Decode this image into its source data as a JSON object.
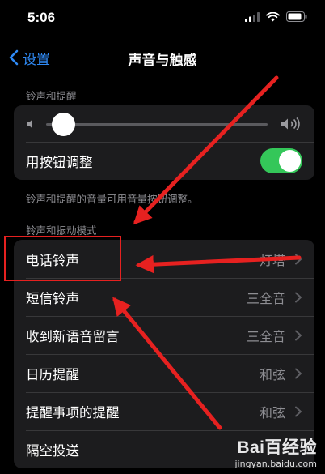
{
  "status": {
    "time": "5:06"
  },
  "nav": {
    "back_label": "设置",
    "title": "声音与触感"
  },
  "ringer": {
    "section_label": "铃声和提醒",
    "volume_level": 0.08,
    "button_adjust_label": "用按钮调整",
    "button_adjust_on": true,
    "footer": "铃声和提醒的音量可用音量按钮调整。"
  },
  "patterns": {
    "section_label": "铃声和振动模式",
    "items": [
      {
        "label": "电话铃声",
        "value": "灯塔"
      },
      {
        "label": "短信铃声",
        "value": "三全音"
      },
      {
        "label": "收到新语音留言",
        "value": "三全音"
      },
      {
        "label": "日历提醒",
        "value": "和弦"
      },
      {
        "label": "提醒事项的提醒",
        "value": "和弦"
      },
      {
        "label": "隔空投送",
        "value": ""
      }
    ]
  },
  "colors": {
    "accent": "#2f8af5",
    "toggle_on": "#34c759",
    "annotation": "#e62120"
  },
  "watermark": {
    "logo": "Bai百经验",
    "url": "jingyan.baidu.com"
  }
}
